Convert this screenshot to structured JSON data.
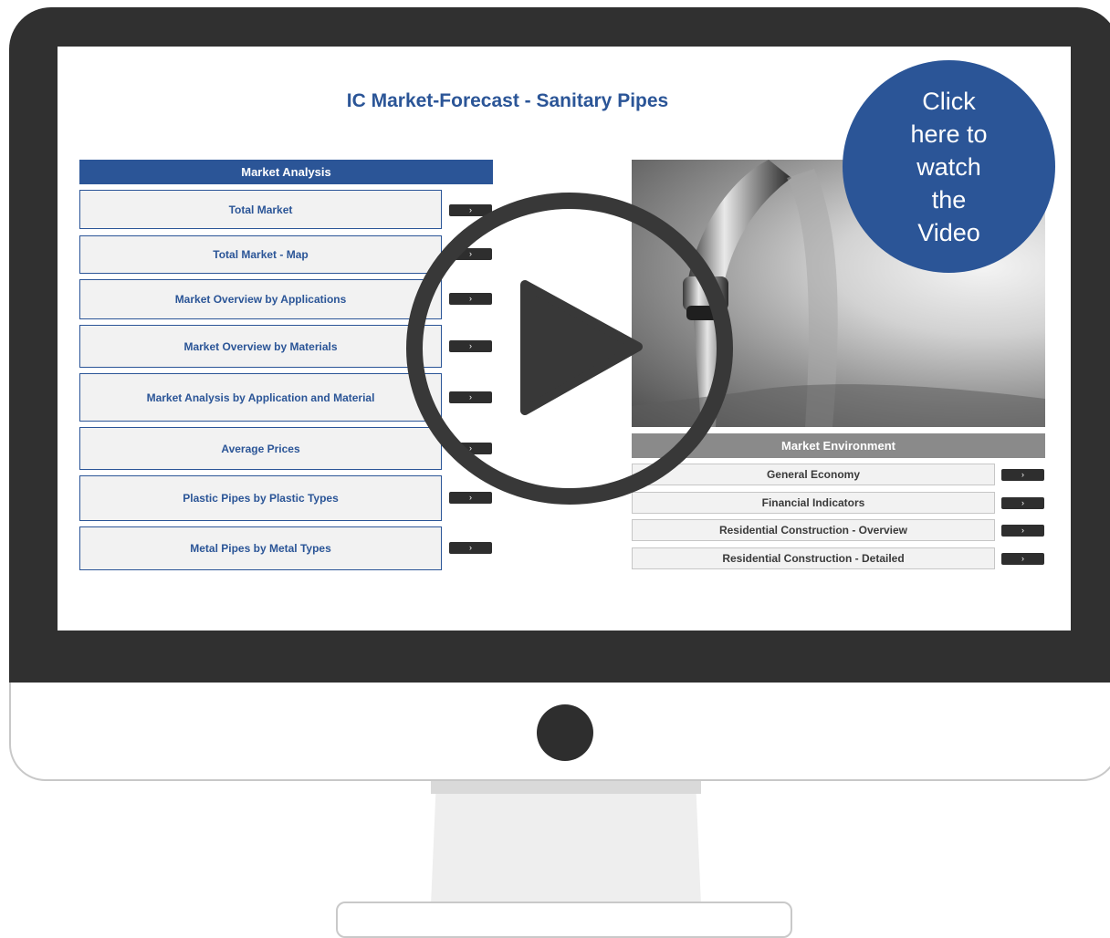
{
  "page": {
    "title": "IC Market-Forecast - Sanitary Pipes"
  },
  "market_analysis": {
    "header": "Market Analysis",
    "items": [
      {
        "label": "Total Market",
        "button": "›"
      },
      {
        "label": "Total Market - Map",
        "button": "›"
      },
      {
        "label": "Market Overview by Applications",
        "button": "›"
      },
      {
        "label": "Market Overview by Materials",
        "button": "›"
      },
      {
        "label": "Market Analysis by Application and Material",
        "button": "›"
      },
      {
        "label": "Average Prices",
        "button": "›"
      },
      {
        "label": "Plastic Pipes by Plastic Types",
        "button": "›"
      },
      {
        "label": "Metal Pipes by Metal Types",
        "button": "›"
      }
    ]
  },
  "market_environment": {
    "header": "Market Environment",
    "items": [
      {
        "label": "General Economy",
        "button": "›"
      },
      {
        "label": "Financial Indicators",
        "button": "›"
      },
      {
        "label": "Residential Construction - Overview",
        "button": "›"
      },
      {
        "label": "Residential Construction - Detailed",
        "button": "›"
      }
    ]
  },
  "video_cta": {
    "lines": [
      "Click",
      "here to",
      "watch",
      "the",
      "Video"
    ]
  },
  "icons": {
    "play": "play-icon",
    "photo": "faucet-photo"
  },
  "colors": {
    "accent": "#2b5597",
    "bezel": "#303030",
    "env_header": "#8a8a8a",
    "button": "#2e2e2e"
  }
}
